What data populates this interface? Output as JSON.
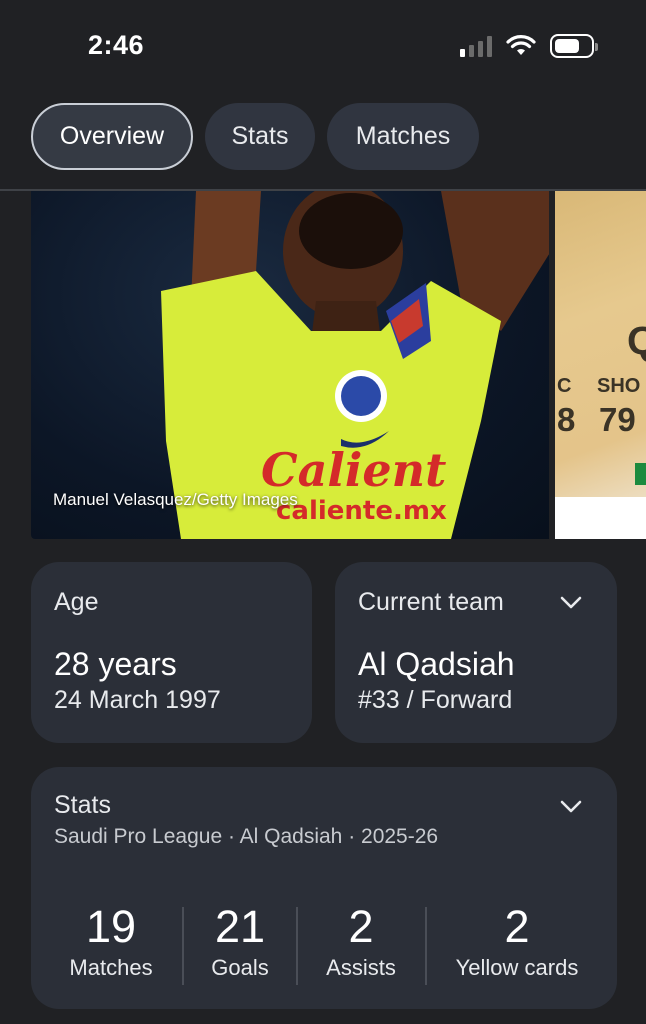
{
  "status_bar": {
    "time": "2:46"
  },
  "tabs": [
    {
      "label": "Overview",
      "active": true
    },
    {
      "label": "Stats",
      "active": false
    },
    {
      "label": "Matches",
      "active": false
    }
  ],
  "media": {
    "photo_credit": "Manuel Velasquez/Getty Images",
    "card_preview": {
      "letter": "Q",
      "stat_labels": [
        "C",
        "SHO"
      ],
      "stat_values": [
        "8",
        "79"
      ]
    }
  },
  "age_card": {
    "label": "Age",
    "value": "28 years",
    "sub": "24 March 1997"
  },
  "team_card": {
    "label": "Current team",
    "value": "Al Qadsiah",
    "sub": "#33 / Forward"
  },
  "stats_card": {
    "title": "Stats",
    "subtitle": "Saudi Pro League · Al Qadsiah · 2025-26",
    "items": [
      {
        "value": "19",
        "label": "Matches"
      },
      {
        "value": "21",
        "label": "Goals"
      },
      {
        "value": "2",
        "label": "Assists"
      },
      {
        "value": "2",
        "label": "Yellow cards"
      }
    ]
  },
  "colors": {
    "background": "#202124",
    "card": "#2b2f38",
    "jersey": "#d7ec3a"
  }
}
